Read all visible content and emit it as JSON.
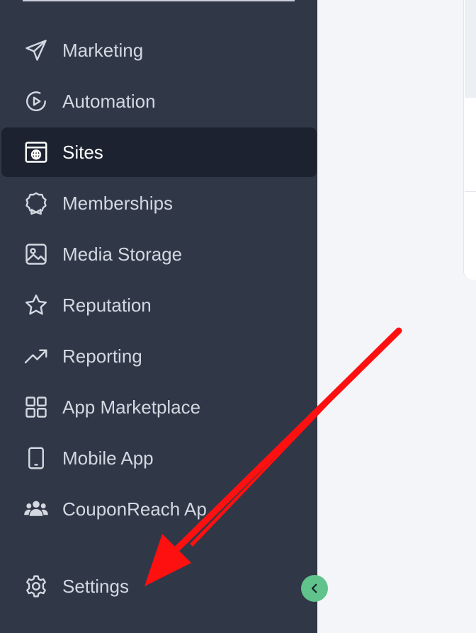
{
  "sidebar": {
    "items": [
      {
        "label": "Marketing",
        "icon": "paper-plane-icon"
      },
      {
        "label": "Automation",
        "icon": "play-circle-icon"
      },
      {
        "label": "Sites",
        "icon": "globe-window-icon",
        "active": true
      },
      {
        "label": "Memberships",
        "icon": "badge-icon"
      },
      {
        "label": "Media Storage",
        "icon": "image-icon"
      },
      {
        "label": "Reputation",
        "icon": "star-icon"
      },
      {
        "label": "Reporting",
        "icon": "trending-up-icon"
      },
      {
        "label": "App Marketplace",
        "icon": "grid-icon"
      },
      {
        "label": "Mobile App",
        "icon": "phone-icon"
      },
      {
        "label": "CouponReach Ap",
        "icon": "users-icon"
      }
    ],
    "settings": {
      "label": "Settings",
      "icon": "gear-icon"
    },
    "collapse_icon": "chevron-left-icon"
  },
  "colors": {
    "sidebar_bg": "#303747",
    "active_bg": "#1d2230",
    "text": "#d3d8e1",
    "accent_green": "#5fc38b",
    "annotation_arrow": "#ff0000"
  }
}
